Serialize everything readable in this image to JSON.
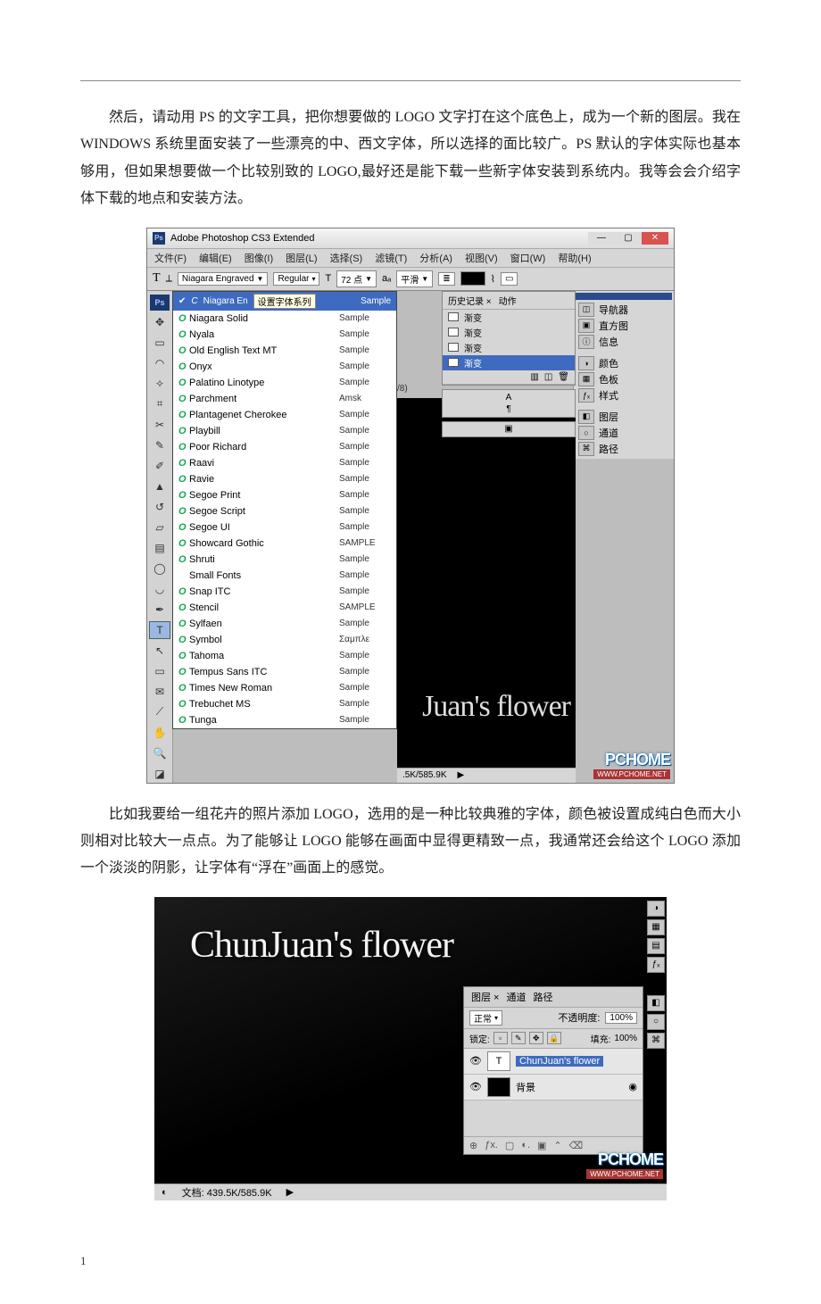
{
  "paragraphs": {
    "p1": "然后，请动用 PS 的文字工具，把你想要做的 LOGO 文字打在这个底色上，成为一个新的图层。我在 WINDOWS 系统里面安装了一些漂亮的中、西文字体，所以选择的面比较广。PS 默认的字体实际也基本够用，但如果想要做一个比较别致的 LOGO,最好还是能下载一些新字体安装到系统内。我等会会介绍字体下载的地点和安装方法。",
    "p2": "比如我要给一组花卉的照片添加 LOGO，选用的是一种比较典雅的字体，颜色被设置成纯白色而大小则相对比较大一点点。为了能够让 LOGO 能够在画面中显得更精致一点，我通常还会给这个 LOGO 添加一个淡淡的阴影，让字体有“浮在”画面上的感觉。"
  },
  "page_number": "1",
  "shot1": {
    "title": "Adobe Photoshop CS3 Extended",
    "menu": [
      "文件(F)",
      "编辑(E)",
      "图像(I)",
      "图层(L)",
      "选择(S)",
      "滤镜(T)",
      "分析(A)",
      "视图(V)",
      "窗口(W)",
      "帮助(H)"
    ],
    "optbar": {
      "tool": "T",
      "orient": "⟂",
      "font": "Niagara Engraved",
      "weight": "Regular",
      "size_icon": "T",
      "size": "72 点",
      "aa_label": "aₐ",
      "aa": "平滑",
      "align": "≣",
      "warp": "⌇",
      "panel": "▭"
    },
    "font_header": {
      "current": "Niagara En",
      "tip": "设置字体系列",
      "preview": "Sample"
    },
    "fonts": [
      {
        "t": "O",
        "n": "Niagara Solid",
        "s": "Sample"
      },
      {
        "t": "O",
        "n": "Nyala",
        "s": "Sample"
      },
      {
        "t": "O",
        "n": "Old English Text MT",
        "s": "Sample"
      },
      {
        "t": "O",
        "n": "Onyx",
        "s": "Sample"
      },
      {
        "t": "O",
        "n": "Palatino Linotype",
        "s": "Sample"
      },
      {
        "t": "O",
        "n": "Parchment",
        "s": "Amsk"
      },
      {
        "t": "O",
        "n": "Plantagenet Cherokee",
        "s": "Sample"
      },
      {
        "t": "O",
        "n": "Playbill",
        "s": "Sample"
      },
      {
        "t": "O",
        "n": "Poor Richard",
        "s": "Sample"
      },
      {
        "t": "O",
        "n": "Raavi",
        "s": "Sample"
      },
      {
        "t": "O",
        "n": "Ravie",
        "s": "Sample"
      },
      {
        "t": "O",
        "n": "Segoe Print",
        "s": "Sample"
      },
      {
        "t": "O",
        "n": "Segoe Script",
        "s": "Sample"
      },
      {
        "t": "O",
        "n": "Segoe UI",
        "s": "Sample"
      },
      {
        "t": "O",
        "n": "Showcard Gothic",
        "s": "SAMPLE"
      },
      {
        "t": "O",
        "n": "Shruti",
        "s": "Sample"
      },
      {
        "t": "",
        "n": "Small Fonts",
        "s": "Sample"
      },
      {
        "t": "O",
        "n": "Snap ITC",
        "s": "Sample"
      },
      {
        "t": "O",
        "n": "Stencil",
        "s": "SAMPLE"
      },
      {
        "t": "O",
        "n": "Sylfaen",
        "s": "Sample"
      },
      {
        "t": "O",
        "n": "Symbol",
        "s": "Σαμπλε"
      },
      {
        "t": "O",
        "n": "Tahoma",
        "s": "Sample"
      },
      {
        "t": "O",
        "n": "Tempus Sans ITC",
        "s": "Sample"
      },
      {
        "t": "O",
        "n": "Times New Roman",
        "s": "Sample"
      },
      {
        "t": "O",
        "n": "Trebuchet MS",
        "s": "Sample"
      },
      {
        "t": "O",
        "n": "Tunga",
        "s": "Sample"
      }
    ],
    "canvas_text": "Juan's flower",
    "canvas_crumb": "/8)",
    "status": ".5K/585.9K",
    "history": {
      "tabs": [
        "历史记录 ×",
        "动作"
      ],
      "items": [
        "渐变",
        "渐变",
        "渐变",
        "渐变"
      ]
    },
    "dock": [
      {
        "i": "◫",
        "l": "导航器"
      },
      {
        "i": "▣",
        "l": "直方图"
      },
      {
        "i": "ⓘ",
        "l": "信息"
      },
      {
        "sep": true
      },
      {
        "i": "◑",
        "l": "颜色"
      },
      {
        "i": "▦",
        "l": "色板"
      },
      {
        "i": "ƒₓ",
        "l": "样式"
      },
      {
        "sep": true
      },
      {
        "i": "◧",
        "l": "图层"
      },
      {
        "i": "○",
        "l": "通道"
      },
      {
        "i": "⌘",
        "l": "路径"
      }
    ],
    "pchome": {
      "logo": "PCHOME",
      "url": "WWW.PCHOME.NET"
    }
  },
  "shot2": {
    "logo_text": "ChunJuan's flower",
    "status_prefix": "文档:",
    "status": "439.5K/585.9K",
    "panel": {
      "tabs": [
        "图层 ×",
        "通道",
        "路径"
      ],
      "blend": "正常",
      "opacity_label": "不透明度:",
      "opacity": "100%",
      "lock_label": "锁定:",
      "fill_label": "填充:",
      "fill": "100%",
      "layers": [
        {
          "name": "ChunJuan's flower",
          "type": "T",
          "selected": true
        },
        {
          "name": "背景",
          "type": "bg",
          "lock": "◉"
        }
      ],
      "foot": [
        "⊕",
        "ƒx.",
        "▢",
        "◐.",
        "▣",
        "⌃",
        "⌫"
      ]
    },
    "tool_icons": [
      "◑",
      "▦",
      "▤",
      "ƒₓ"
    ],
    "right_icons": [
      "◧",
      "○",
      "⌘"
    ],
    "pchome": {
      "logo": "PCHOME",
      "url": "WWW.PCHOME.NET"
    }
  }
}
